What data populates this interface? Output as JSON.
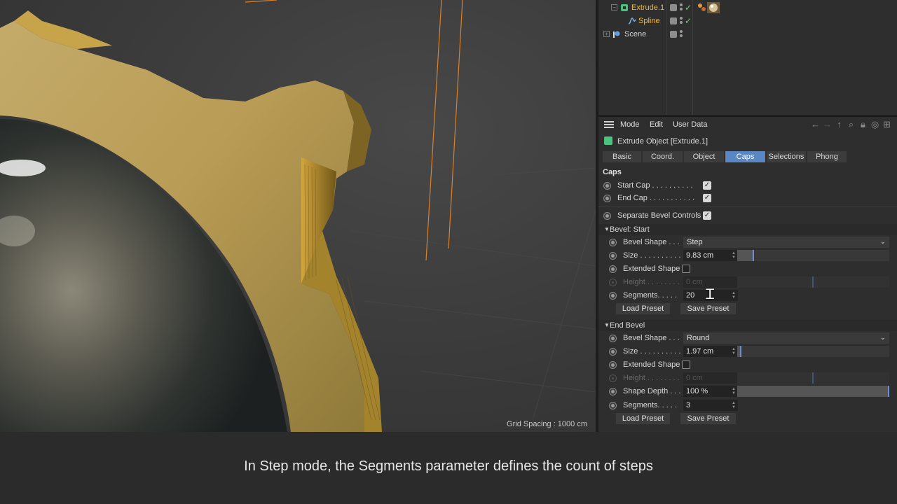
{
  "viewport": {
    "grid_spacing_label": "Grid Spacing : 1000 cm"
  },
  "object_manager": {
    "objects": [
      {
        "name": "Extrude.1",
        "color": "#f0b93b",
        "icon": "extrude-icon",
        "selected": true
      },
      {
        "name": "Spline",
        "color": "#f0b93b",
        "icon": "spline-icon"
      },
      {
        "name": "Scene",
        "color": "#d4d4d4",
        "icon": "scene-icon"
      }
    ]
  },
  "attribute_manager": {
    "menu": [
      "Mode",
      "Edit",
      "User Data"
    ],
    "title": "Extrude Object [Extrude.1]",
    "tabs": [
      "Basic",
      "Coord.",
      "Object",
      "Caps",
      "Selections",
      "Phong"
    ],
    "active_tab": "Caps",
    "caps_label": "Caps",
    "start_cap": {
      "label": "Start Cap . . . . . . . . . .",
      "checked": true
    },
    "end_cap": {
      "label": "End Cap . . . . . . . . . . .",
      "checked": true
    },
    "separate_bevel": {
      "label": "Separate Bevel Controls",
      "checked": true
    },
    "bevel_start": {
      "heading": "Bevel: Start",
      "shape_label": "Bevel Shape . . .",
      "shape_value": "Step",
      "size_label": "Size . . . . . . . . . .",
      "size_value": "9.83 cm",
      "size_fraction": 0.1,
      "extended_label": "Extended Shape",
      "height_label": "Height . . . . . . . .",
      "height_value": "0 cm",
      "segments_label": "Segments. . . . .",
      "segments_value": "20",
      "load_label": "Load Preset",
      "save_label": "Save Preset"
    },
    "end_bevel": {
      "heading": "End Bevel",
      "shape_label": "Bevel Shape . . .",
      "shape_value": "Round",
      "size_label": "Size . . . . . . . . . .",
      "size_value": "1.97 cm",
      "size_fraction": 0.02,
      "extended_label": "Extended Shape",
      "height_label": "Height . . . . . . . .",
      "height_value": "0 cm",
      "depth_label": "Shape Depth . . .",
      "depth_value": "100 %",
      "depth_fraction": 1.0,
      "segments_label": "Segments. . . . .",
      "segments_value": "3",
      "load_label": "Load Preset",
      "save_label": "Save Preset"
    }
  },
  "subtitle": "In Step mode, the Segments parameter defines the count of steps",
  "colors": {
    "accent": "#5b86c4",
    "object_selected": "#f0b93b",
    "bevel_gold": "#c9a645"
  }
}
